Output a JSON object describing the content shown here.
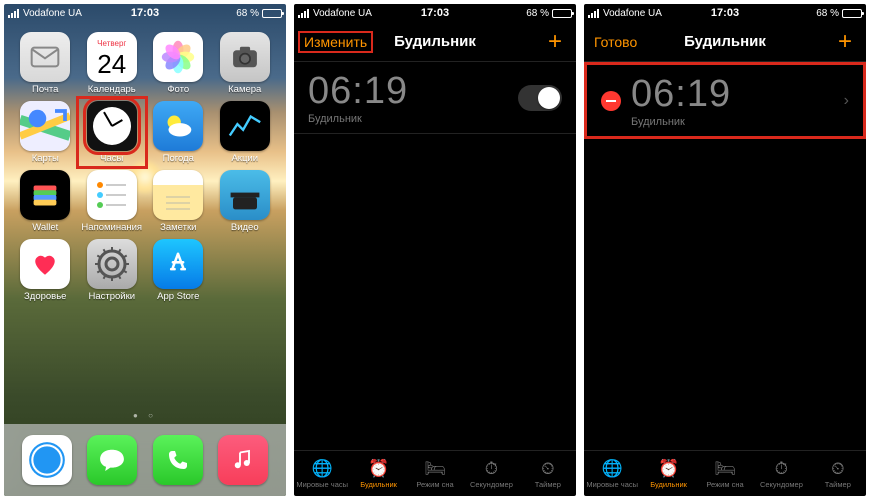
{
  "status": {
    "carrier": "Vodafone UA",
    "time": "17:03",
    "battery_pct": "68 %",
    "battery_fill": 68
  },
  "home": {
    "calendar": {
      "weekday": "Четверг",
      "day": "24"
    },
    "apps": [
      {
        "label": "Почта",
        "icon": "mail"
      },
      {
        "label": "Календарь",
        "icon": "cal"
      },
      {
        "label": "Фото",
        "icon": "photo"
      },
      {
        "label": "Камера",
        "icon": "cam"
      },
      {
        "label": "Карты",
        "icon": "maps"
      },
      {
        "label": "Часы",
        "icon": "clock",
        "highlight": true
      },
      {
        "label": "Погода",
        "icon": "weather"
      },
      {
        "label": "Акции",
        "icon": "stocks"
      },
      {
        "label": "Wallet",
        "icon": "wallet"
      },
      {
        "label": "Напоминания",
        "icon": "rem"
      },
      {
        "label": "Заметки",
        "icon": "notes"
      },
      {
        "label": "Видео",
        "icon": "video"
      },
      {
        "label": "Здоровье",
        "icon": "health"
      },
      {
        "label": "Настройки",
        "icon": "set"
      },
      {
        "label": "App Store",
        "icon": "store"
      }
    ],
    "dock": [
      {
        "label": "Safari",
        "icon": "safari"
      },
      {
        "label": "Сообщения",
        "icon": "msg"
      },
      {
        "label": "Телефон",
        "icon": "phone"
      },
      {
        "label": "Музыка",
        "icon": "music"
      }
    ]
  },
  "screen2": {
    "nav_left": "Изменить",
    "nav_title": "Будильник",
    "nav_plus": "+",
    "alarm_time": "06:19",
    "alarm_sub": "Будильник",
    "highlight_nav_left": true
  },
  "screen3": {
    "nav_left": "Готово",
    "nav_title": "Будильник",
    "nav_plus": "+",
    "alarm_time": "06:19",
    "alarm_sub": "Будильник",
    "highlight_row": true
  },
  "tabs": [
    {
      "label": "Мировые часы",
      "icon": "🌐"
    },
    {
      "label": "Будильник",
      "icon": "⏰",
      "active": true
    },
    {
      "label": "Режим сна",
      "icon": "🛏"
    },
    {
      "label": "Секундомер",
      "icon": "⏱"
    },
    {
      "label": "Таймер",
      "icon": "⏲"
    }
  ]
}
